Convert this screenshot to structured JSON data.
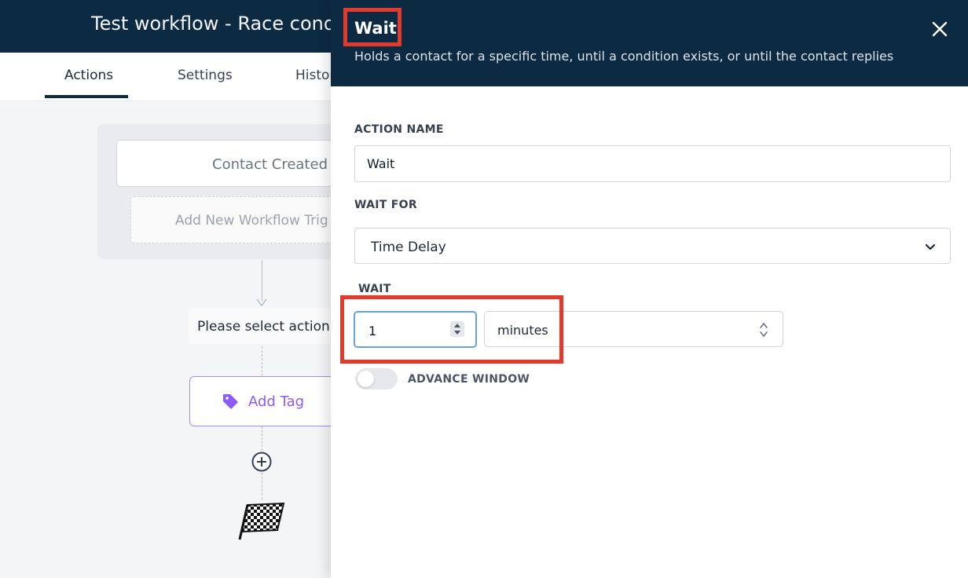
{
  "workflow": {
    "title": "Test workflow - Race conditio",
    "tabs": [
      {
        "label": "Actions",
        "active": true
      },
      {
        "label": "Settings",
        "active": false
      },
      {
        "label": "Histor",
        "active": false
      }
    ],
    "trigger": {
      "label": "Contact Created",
      "add_label": "Add New Workflow Trig"
    },
    "steps": {
      "select_action_label": "Please select action",
      "add_tag_label": "Add Tag",
      "add_tag_icon": "tag-icon",
      "add_step_icon": "plus-circle-icon",
      "end_icon": "checkered-flag-icon"
    }
  },
  "drawer": {
    "title": "Wait",
    "subtitle": "Holds a contact for a specific time, until a condition exists, or until the contact replies",
    "close_icon": "close-icon",
    "action_name": {
      "label": "ACTION NAME",
      "value": "Wait"
    },
    "wait_for": {
      "label": "WAIT FOR",
      "value": "Time Delay",
      "icon": "chevron-down-icon"
    },
    "wait": {
      "label": "WAIT",
      "amount": "1",
      "unit": "minutes"
    },
    "advance_window": {
      "label": "ADVANCE WINDOW",
      "enabled": false
    }
  },
  "colors": {
    "header_bg": "#0d2a43",
    "highlight": "#e23a2c",
    "tag_accent": "#8b5cf6",
    "focus_border": "#6aa2d8"
  }
}
